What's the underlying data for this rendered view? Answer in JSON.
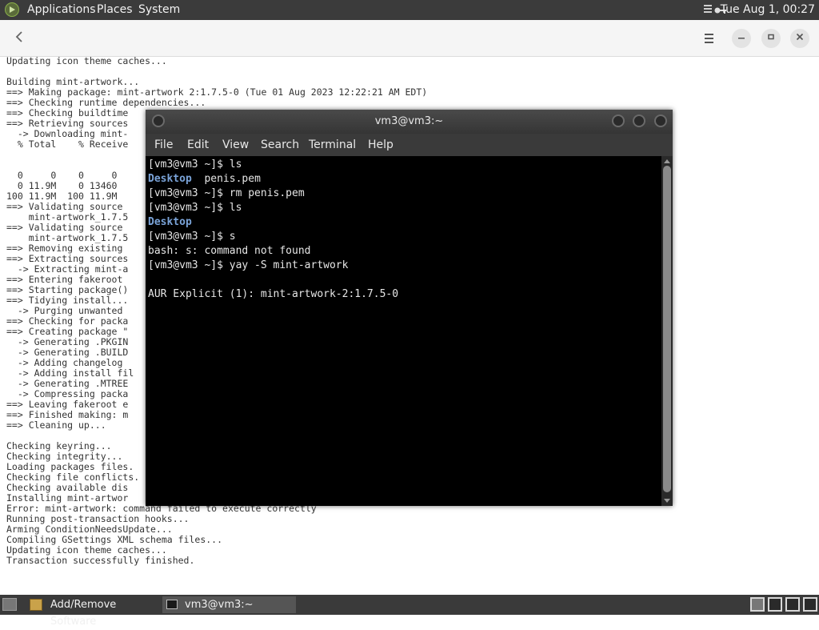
{
  "top_panel": {
    "menus": [
      "Applications",
      "Places",
      "System"
    ],
    "clock": "Tue Aug  1, 00:27"
  },
  "background_window": {
    "log_lines": [
      "Updating icon theme caches...",
      "",
      "Building mint-artwork...",
      "==> Making package: mint-artwork 2:1.7.5-0 (Tue 01 Aug 2023 12:22:21 AM EDT)",
      "==> Checking runtime dependencies...",
      "==> Checking buildtime",
      "==> Retrieving sources",
      "  -> Downloading mint-",
      "  % Total    % Receive",
      "",
      "",
      "  0     0    0     0",
      "  0 11.9M    0 13460",
      "100 11.9M  100 11.9M",
      "==> Validating source",
      "    mint-artwork_1.7.5",
      "==> Validating source",
      "    mint-artwork_1.7.5",
      "==> Removing existing",
      "==> Extracting sources",
      "  -> Extracting mint-a",
      "==> Entering fakeroot",
      "==> Starting package()",
      "==> Tidying install...",
      "  -> Purging unwanted",
      "==> Checking for packa",
      "==> Creating package \"",
      "  -> Generating .PKGIN",
      "  -> Generating .BUILD",
      "  -> Adding changelog",
      "  -> Adding install fil",
      "  -> Generating .MTREE",
      "  -> Compressing packa",
      "==> Leaving fakeroot e",
      "==> Finished making: m",
      "==> Cleaning up...",
      "",
      "Checking keyring...",
      "Checking integrity...",
      "Loading packages files.",
      "Checking file conflicts.",
      "Checking available dis",
      "Installing mint-artwor",
      "Error: mint-artwork: command failed to execute correctly",
      "Running post-transaction hooks...",
      "Arming ConditionNeedsUpdate...",
      "Compiling GSettings XML schema files...",
      "Updating icon theme caches...",
      "Transaction successfully finished."
    ]
  },
  "terminal": {
    "title": "vm3@vm3:~",
    "menu": [
      "File",
      "Edit",
      "View",
      "Search",
      "Terminal",
      "Help"
    ],
    "lines": {
      "l1": "[vm3@vm3 ~]$ ls",
      "l2_dir": "Desktop",
      "l2_file": "  penis.pem",
      "l3": "[vm3@vm3 ~]$ rm penis.pem",
      "l4": "[vm3@vm3 ~]$ ls",
      "l5_dir": "Desktop",
      "l6": "[vm3@vm3 ~]$ s",
      "l7": "bash: s: command not found",
      "l8": "[vm3@vm3 ~]$ yay -S mint-artwork",
      "l9": "",
      "l10": "AUR Explicit (1): mint-artwork-2:1.7.5-0"
    }
  },
  "taskbar": {
    "tasks": [
      "Add/Remove Software",
      "vm3@vm3:~"
    ]
  }
}
